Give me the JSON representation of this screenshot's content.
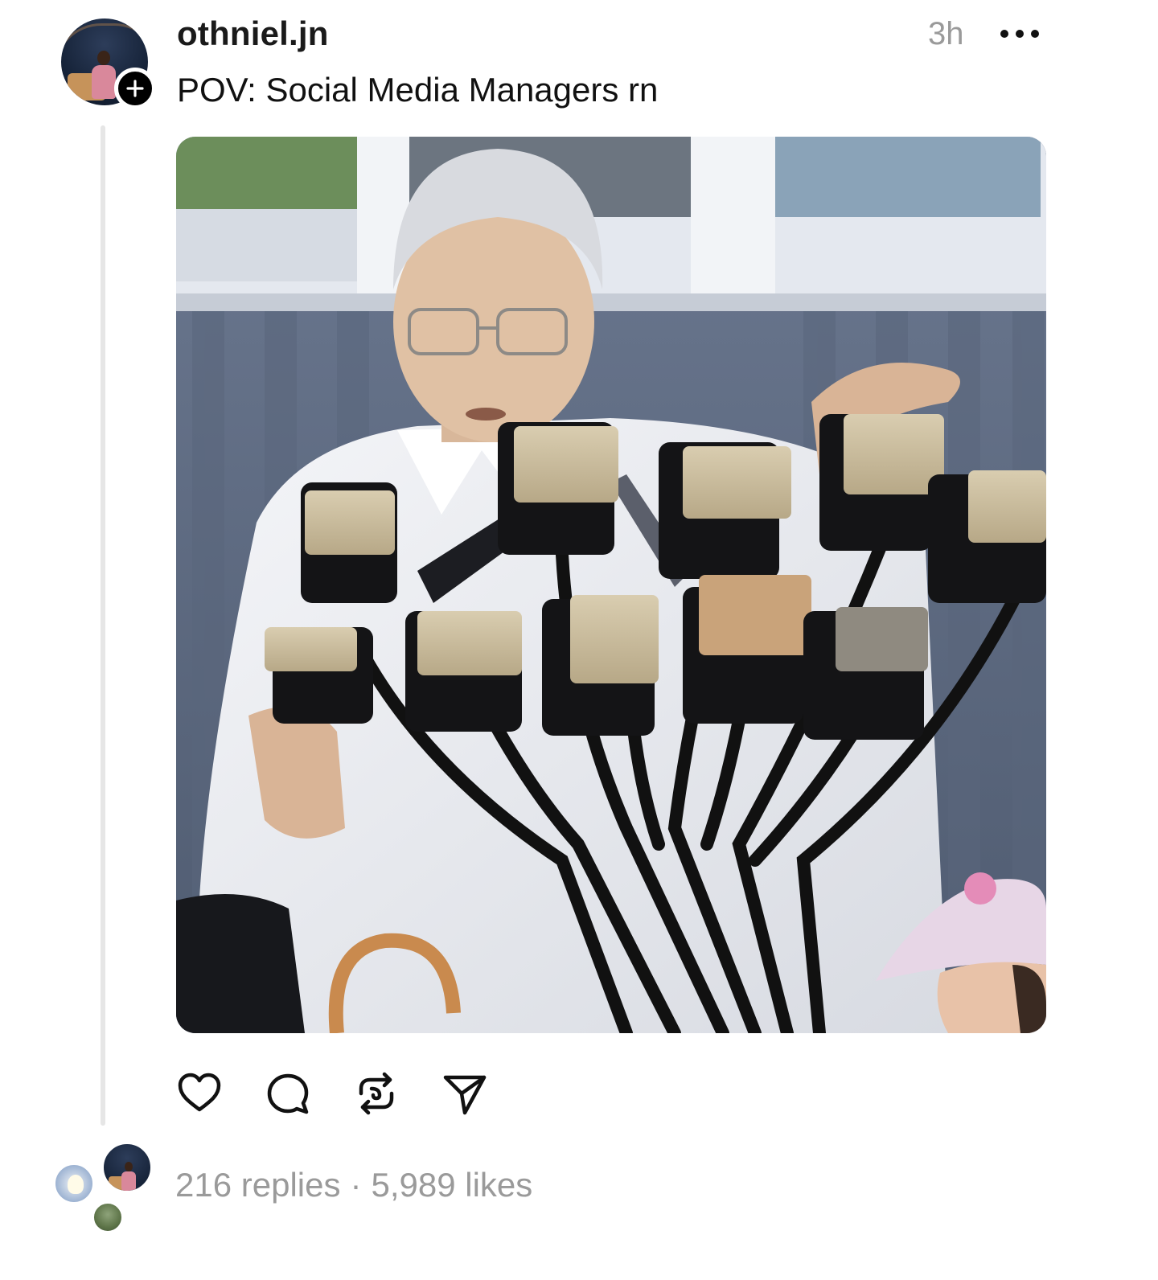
{
  "post": {
    "username": "othniel.jn",
    "time": "3h",
    "caption": "POV: Social Media Managers rn",
    "more_icon": "more-horizontal-icon",
    "follow_icon": "plus-icon"
  },
  "actions": [
    {
      "name": "like",
      "icon": "heart-icon"
    },
    {
      "name": "reply",
      "icon": "comment-icon"
    },
    {
      "name": "repost",
      "icon": "repost-icon"
    },
    {
      "name": "share",
      "icon": "send-icon"
    }
  ],
  "stats": {
    "replies": "216 replies",
    "separator": "·",
    "likes": "5,989 likes"
  },
  "colors": {
    "text": "#111111",
    "muted": "#9a9a9a",
    "thread_line": "#e6e6e6"
  }
}
